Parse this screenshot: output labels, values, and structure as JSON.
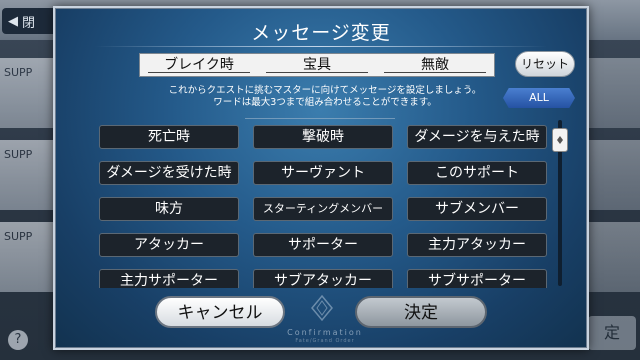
{
  "background": {
    "back_label": "閉",
    "side_labels": [
      "SUPP",
      "SUPP",
      "SUPP"
    ],
    "help_glyph": "?",
    "right_button_label": "定"
  },
  "dialog": {
    "title": "メッセージ変更",
    "slots": [
      "ブレイク時",
      "宝具",
      "無敵"
    ],
    "reset_label": "リセット",
    "description_line1": "これからクエストに挑むマスターに向けてメッセージを設定しましょう。",
    "description_line2": "ワードは最大3つまで組み合わせることができます。",
    "filter_label": "ALL",
    "words": [
      "死亡時",
      "撃破時",
      "ダメージを与えた時",
      "ダメージを受けた時",
      "サーヴァント",
      "このサポート",
      "味方",
      "スターティングメンバー",
      "サブメンバー",
      "アタッカー",
      "サポーター",
      "主力アタッカー",
      "主力サポーター",
      "サブアタッカー",
      "サブサポーター"
    ],
    "cancel_label": "キャンセル",
    "ok_label": "決定",
    "confirm_caption": "Confirmation",
    "confirm_subcaption": "Fate/Grand Order"
  },
  "colors": {
    "panel": "#245a8a",
    "word_bg": "#1c232b",
    "filter_tab": "#2d5fb0"
  },
  "icons": [
    "back-arrow-icon",
    "help-icon",
    "scroll-handle-icon",
    "emblem-icon"
  ]
}
